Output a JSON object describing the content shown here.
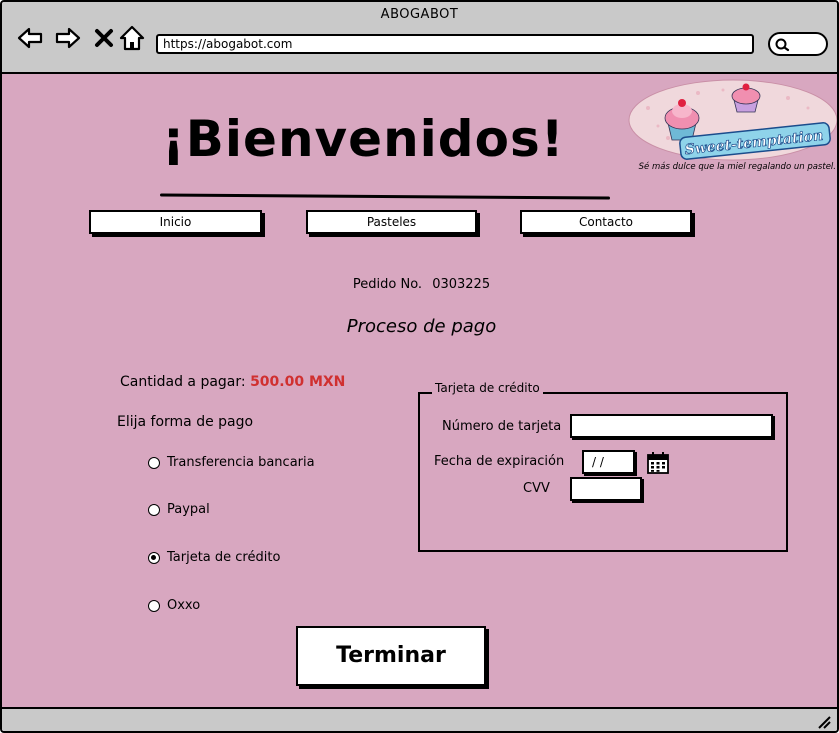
{
  "browser": {
    "window_title": "ABOGABOT",
    "url": "https://abogabot.com",
    "icons": [
      "back-arrow-icon",
      "forward-arrow-icon",
      "close-x-icon",
      "home-icon",
      "search-icon"
    ]
  },
  "header": {
    "headline": "¡Bienvenidos!",
    "logo_text": "Sweet-temptation",
    "slogan": "Sé más dulce que la miel regalando un pastel."
  },
  "menu": [
    {
      "label": "Inicio"
    },
    {
      "label": "Pasteles"
    },
    {
      "label": "Contacto"
    }
  ],
  "order": {
    "label": "Pedido No.",
    "number": "0303225"
  },
  "process_title": "Proceso de pago",
  "amount": {
    "label": "Cantidad a pagar:",
    "value": "500.00 MXN",
    "value_color": "#d03030"
  },
  "payment": {
    "prompt": "Elija forma de pago",
    "options": [
      {
        "label": "Transferencia bancaria",
        "checked": false
      },
      {
        "label": "Paypal",
        "checked": false
      },
      {
        "label": "Tarjeta de crédito",
        "checked": true
      },
      {
        "label": "Oxxo",
        "checked": false
      }
    ]
  },
  "card": {
    "legend": "Tarjeta de crédito",
    "number_label": "Número de tarjeta",
    "number_value": "",
    "expiry_label": "Fecha de expiración",
    "expiry_value": "/ /",
    "cvv_label": "CVV",
    "cvv_value": ""
  },
  "finish_label": "Terminar",
  "colors": {
    "page_background": "#d8a7c0",
    "chrome": "#c9c9c9",
    "accent_amount": "#d03030"
  }
}
